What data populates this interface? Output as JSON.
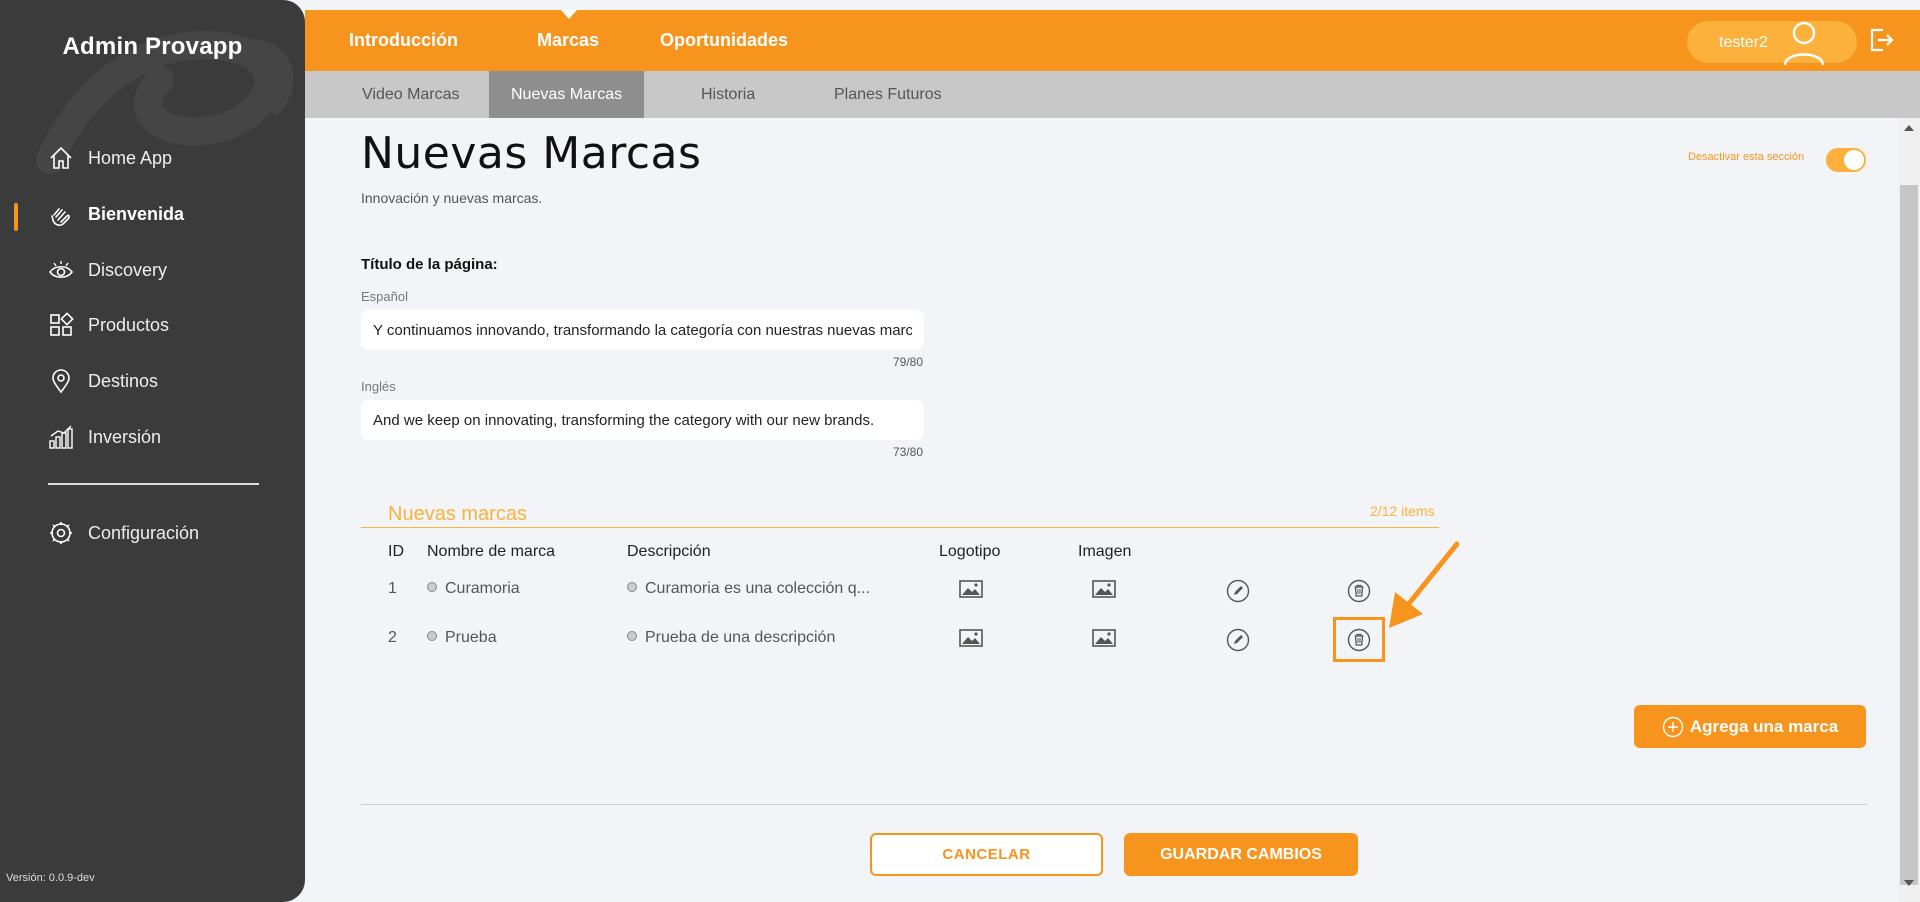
{
  "sidebar": {
    "brand": "Admin Provapp",
    "items": [
      {
        "label": "Home App",
        "icon": "home-icon"
      },
      {
        "label": "Bienvenida",
        "icon": "wave-hand-icon",
        "active": true
      },
      {
        "label": "Discovery",
        "icon": "eye-icon"
      },
      {
        "label": "Productos",
        "icon": "grid-icon"
      },
      {
        "label": "Destinos",
        "icon": "map-pin-icon"
      },
      {
        "label": "Inversión",
        "icon": "bar-chart-icon"
      },
      {
        "label": "Configuración",
        "icon": "settings-icon"
      }
    ],
    "version": "Versión: 0.0.9-dev"
  },
  "topbar": {
    "tabs": [
      "Introducción",
      "Marcas",
      "Oportunidades"
    ],
    "active_tab": "Marcas",
    "username": "tester2"
  },
  "subtabs": {
    "items": [
      "Video Marcas",
      "Nuevas Marcas",
      "Historia",
      "Planes Futuros"
    ],
    "active": "Nuevas Marcas"
  },
  "page": {
    "title": "Nuevas Marcas",
    "subtitle": "Innovación y nuevas marcas.",
    "toggle_label": "Desactivar esta sección",
    "field_title": "Título de la página:",
    "spanish_label": "Español",
    "spanish_value": "Y continuamos innovando, transformando la categoría con nuestras nuevas marcas.",
    "spanish_counter": "79/80",
    "english_label": "Inglés",
    "english_value": "And we keep on innovating, transforming the category with our new brands.",
    "english_counter": "73/80"
  },
  "brands": {
    "title": "Nuevas marcas",
    "count": "2/12 items",
    "columns": [
      "ID",
      "Nombre de marca",
      "Descripción",
      "Logotipo",
      "Imagen"
    ],
    "rows": [
      {
        "id": "1",
        "name": "Curamoria",
        "description": "Curamoria es una colección q..."
      },
      {
        "id": "2",
        "name": "Prueba",
        "description": "Prueba de una descripción"
      }
    ],
    "add_label": "Agrega una marca"
  },
  "actions": {
    "cancel": "CANCELAR",
    "save": "GUARDAR CAMBIOS"
  },
  "colors": {
    "accent": "#f7941d",
    "accent_light": "#fbb13c",
    "sidebar_bg": "#3b3b3b"
  }
}
